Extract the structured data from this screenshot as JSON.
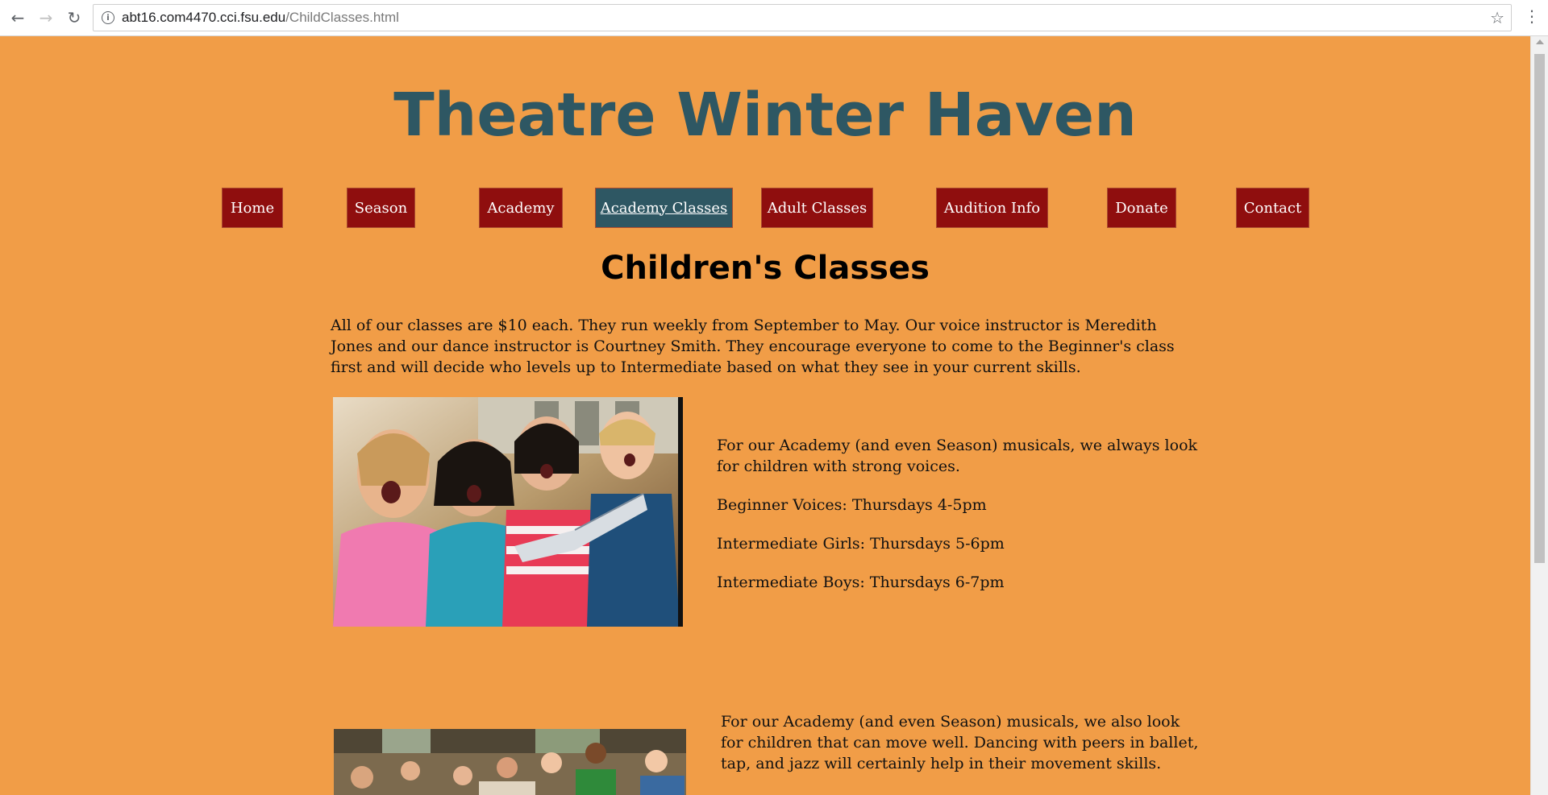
{
  "browser": {
    "url_host": "abt16.com4470.cci.fsu.edu",
    "url_path": "/ChildClasses.html"
  },
  "site": {
    "title": "Theatre Winter Haven"
  },
  "nav": {
    "items": [
      {
        "label": "Home"
      },
      {
        "label": "Season"
      },
      {
        "label": "Academy"
      },
      {
        "label": "Academy Classes",
        "active": true
      },
      {
        "label": "Adult Classes"
      },
      {
        "label": "Audition Info"
      },
      {
        "label": "Donate"
      },
      {
        "label": "Contact"
      }
    ]
  },
  "page": {
    "heading": "Children's Classes",
    "intro": "All of our classes are $10 each. They run weekly from September to May. Our voice instructor is Meredith Jones and our dance instructor is Courtney Smith. They encourage everyone to come to the Beginner's class first and will decide who levels up to Intermediate based on what they see in your current skills.",
    "voice_section": {
      "description": "For our Academy (and even Season) musicals, we always look for children with strong voices.",
      "classes": [
        "Beginner Voices: Thursdays 4-5pm",
        "Intermediate Girls: Thursdays 5-6pm",
        "Intermediate Boys: Thursdays 6-7pm"
      ]
    },
    "dance_section": {
      "description": "For our Academy (and even Season) musicals, we also look for children that can move well. Dancing with peers in ballet, tap, and jazz will certainly help in their movement skills."
    }
  },
  "colors": {
    "background": "#f19d47",
    "title": "#2e5763",
    "nav_bg": "#8f0e0e",
    "nav_active_bg": "#2e5763"
  }
}
